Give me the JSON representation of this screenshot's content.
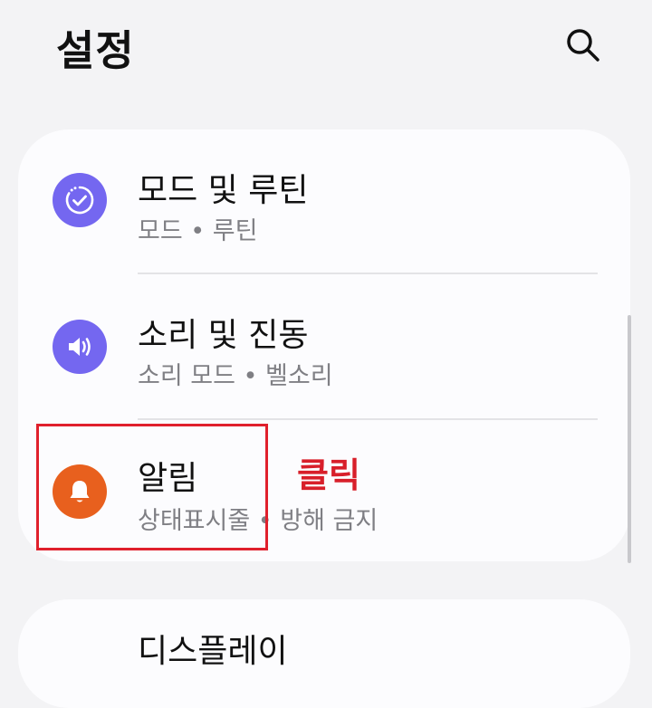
{
  "header": {
    "title": "설정",
    "search_icon": "search-icon"
  },
  "settings": [
    {
      "title": "모드 및 루틴",
      "subtitle": "모드 • 루틴",
      "icon": "modes-routines-icon",
      "icon_color": "#7467f0"
    },
    {
      "title": "소리 및 진동",
      "subtitle": "소리 모드 • 벨소리",
      "icon": "volume-icon",
      "icon_color": "#7467f0"
    },
    {
      "title": "알림",
      "subtitle": "상태표시줄 • 방해 금지",
      "icon": "bell-icon",
      "icon_color": "#e8601e"
    }
  ],
  "annotation": {
    "label": "클릭",
    "color": "#d81f2a"
  },
  "partial_next_item": {
    "title": "디스플레이"
  }
}
